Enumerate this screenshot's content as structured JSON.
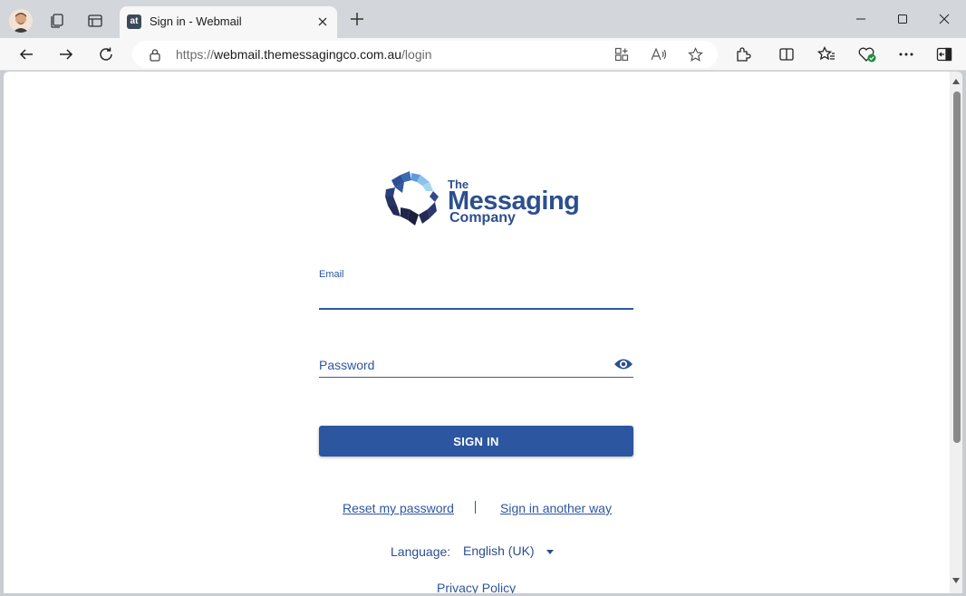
{
  "browser": {
    "tab": {
      "favicon_text": "at",
      "title": "Sign in - Webmail"
    },
    "address": {
      "url_prefix": "https://",
      "url_host": "webmail.themessagingco.com.au",
      "url_path": "/login"
    }
  },
  "logo": {
    "line1": "The",
    "line2": "Messaging",
    "line3": "Company"
  },
  "form": {
    "email_label": "Email",
    "email_value": "",
    "password_placeholder": "Password",
    "signin_label": "SIGN IN"
  },
  "links": {
    "reset": "Reset my password",
    "another": "Sign in another way",
    "privacy": "Privacy Policy"
  },
  "language": {
    "label": "Language:",
    "selected": "English (UK)"
  },
  "colors": {
    "brand": "#2c56a0",
    "logo_dark": "#1f2a52",
    "logo_light": "#4a8fd6"
  }
}
